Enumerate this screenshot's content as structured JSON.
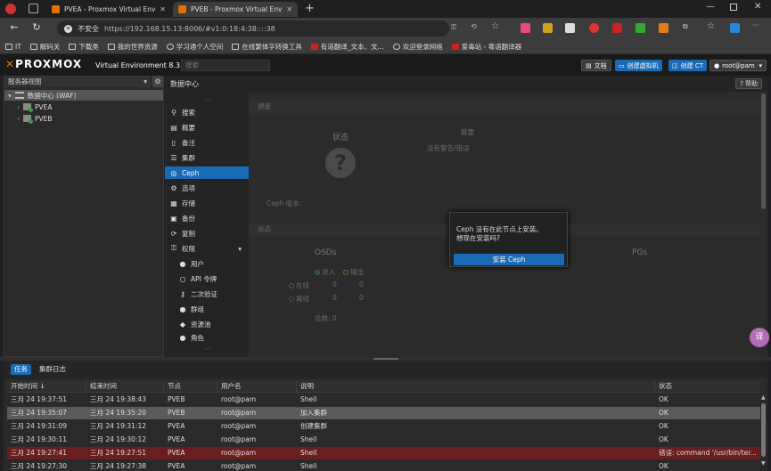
{
  "browser": {
    "tabs": [
      {
        "title": "PVEA - Proxmox Virtual Environment"
      },
      {
        "title": "PVEB - Proxmox Virtual Environment"
      }
    ],
    "security_label": "不安全",
    "url": "https://192.168.15.13:8006/#v1:0:18:4:38::::38",
    "bookmarks": [
      "IT",
      "解码关",
      "下载类",
      "我的世界资源",
      "学习通个人空间",
      "在线繁体字转换工具",
      "有道翻译_文本、文...",
      "欢迎登录网络",
      "爱毒站 - 粤语翻译器"
    ]
  },
  "pve": {
    "logo": "PROXMOX",
    "version": "Virtual Environment 8.3.0",
    "search_placeholder": "搜索",
    "buttons": {
      "docs": "文档",
      "create_vm": "创建虚拟机",
      "create_ct": "创建 CT",
      "user": "root@pam"
    }
  },
  "tree": {
    "view": "服务器视图",
    "root": "数据中心 (WAF)",
    "nodes": [
      "PVEA",
      "PVEB"
    ]
  },
  "content": {
    "breadcrumb": "数据中心",
    "help": "帮助"
  },
  "menu": [
    {
      "label": "搜索",
      "icon": "search-icon"
    },
    {
      "label": "概要",
      "icon": "summary-icon"
    },
    {
      "label": "备注",
      "icon": "notes-icon"
    },
    {
      "label": "集群",
      "icon": "cluster-icon"
    },
    {
      "label": "Ceph",
      "icon": "ceph-icon"
    },
    {
      "label": "选项",
      "icon": "gear-icon"
    },
    {
      "label": "存储",
      "icon": "storage-icon"
    },
    {
      "label": "备份",
      "icon": "backup-icon"
    },
    {
      "label": "复制",
      "icon": "replication-icon"
    },
    {
      "label": "权限",
      "icon": "permissions-icon"
    },
    {
      "label": "用户",
      "icon": "user-icon"
    },
    {
      "label": "API 令牌",
      "icon": "token-icon"
    },
    {
      "label": "二次验证",
      "icon": "tfa-icon"
    },
    {
      "label": "群组",
      "icon": "group-icon"
    },
    {
      "label": "资源池",
      "icon": "pool-icon"
    },
    {
      "label": "角色",
      "icon": "role-icon"
    }
  ],
  "ceph": {
    "health_section": "健康",
    "status_label": "状态",
    "summary_label": "概要",
    "no_warnings": "没有警告/错误",
    "version_label": "Ceph 版本:",
    "status_section": "状态",
    "osds_title": "OSDs",
    "pgs_title": "PGs",
    "in_label": "进入",
    "out_label": "输出",
    "up_label": "在线",
    "down_label": "离线",
    "counts": {
      "up_in": "0",
      "up_out": "0",
      "down_in": "0",
      "down_out": "0"
    },
    "total_label": "总数: 0"
  },
  "modal": {
    "message_line1": "Ceph 没有在此节点上安装。",
    "message_line2": "想现在安装吗?",
    "install_button": "安装 Ceph"
  },
  "tasks": {
    "tabs": [
      "任务",
      "集群日志"
    ],
    "columns": [
      "开始时间 ↓",
      "结束时间",
      "节点",
      "用户名",
      "说明",
      "状态"
    ],
    "rows": [
      {
        "start": "三月 24 19:37:51",
        "end": "三月 24 19:38:43",
        "node": "PVEB",
        "user": "root@pam",
        "desc": "Shell",
        "status": "OK"
      },
      {
        "start": "三月 24 19:35:07",
        "end": "三月 24 19:35:20",
        "node": "PVEB",
        "user": "root@pam",
        "desc": "加入集群",
        "status": "OK"
      },
      {
        "start": "三月 24 19:31:09",
        "end": "三月 24 19:31:12",
        "node": "PVEA",
        "user": "root@pam",
        "desc": "创建集群",
        "status": "OK"
      },
      {
        "start": "三月 24 19:30:11",
        "end": "三月 24 19:30:12",
        "node": "PVEA",
        "user": "root@pam",
        "desc": "Shell",
        "status": "OK"
      },
      {
        "start": "三月 24 19:27:41",
        "end": "三月 24 19:27:51",
        "node": "PVEA",
        "user": "root@pam",
        "desc": "Shell",
        "status": "错误: command '/usr/bin/ter..."
      },
      {
        "start": "三月 24 19:27:30",
        "end": "三月 24 19:27:38",
        "node": "PVEA",
        "user": "root@pam",
        "desc": "Shell",
        "status": "OK"
      }
    ]
  },
  "colors": {
    "accent": "#1a6bb5",
    "brand": "#e57000",
    "error_row": "#6b1e1e",
    "selected_row": "#5a5a5a"
  }
}
